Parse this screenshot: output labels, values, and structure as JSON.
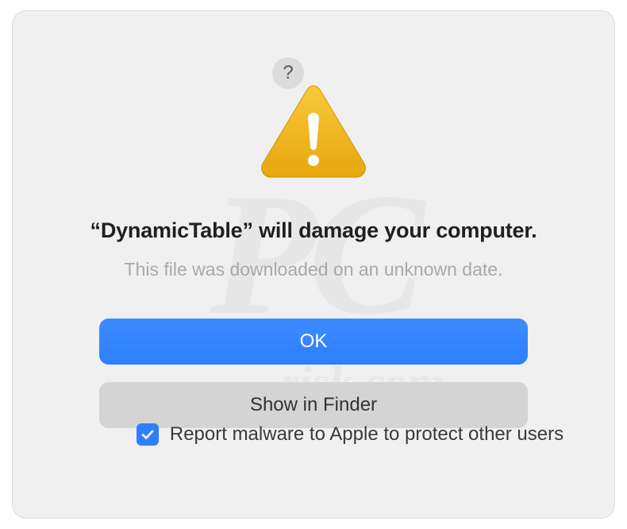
{
  "dialog": {
    "title": "“DynamicTable” will damage your computer.",
    "subtitle": "This file was downloaded on an unknown date.",
    "help_label": "?",
    "buttons": {
      "ok": "OK",
      "show_in_finder": "Show in Finder"
    },
    "checkbox": {
      "checked": true,
      "label": "Report malware to Apple to protect other users"
    }
  },
  "colors": {
    "primary": "#2f7eff",
    "warning_fill": "#f5b400",
    "warning_stroke": "#d49a00"
  },
  "watermark": {
    "main": "PC",
    "sub": "risk.com"
  }
}
